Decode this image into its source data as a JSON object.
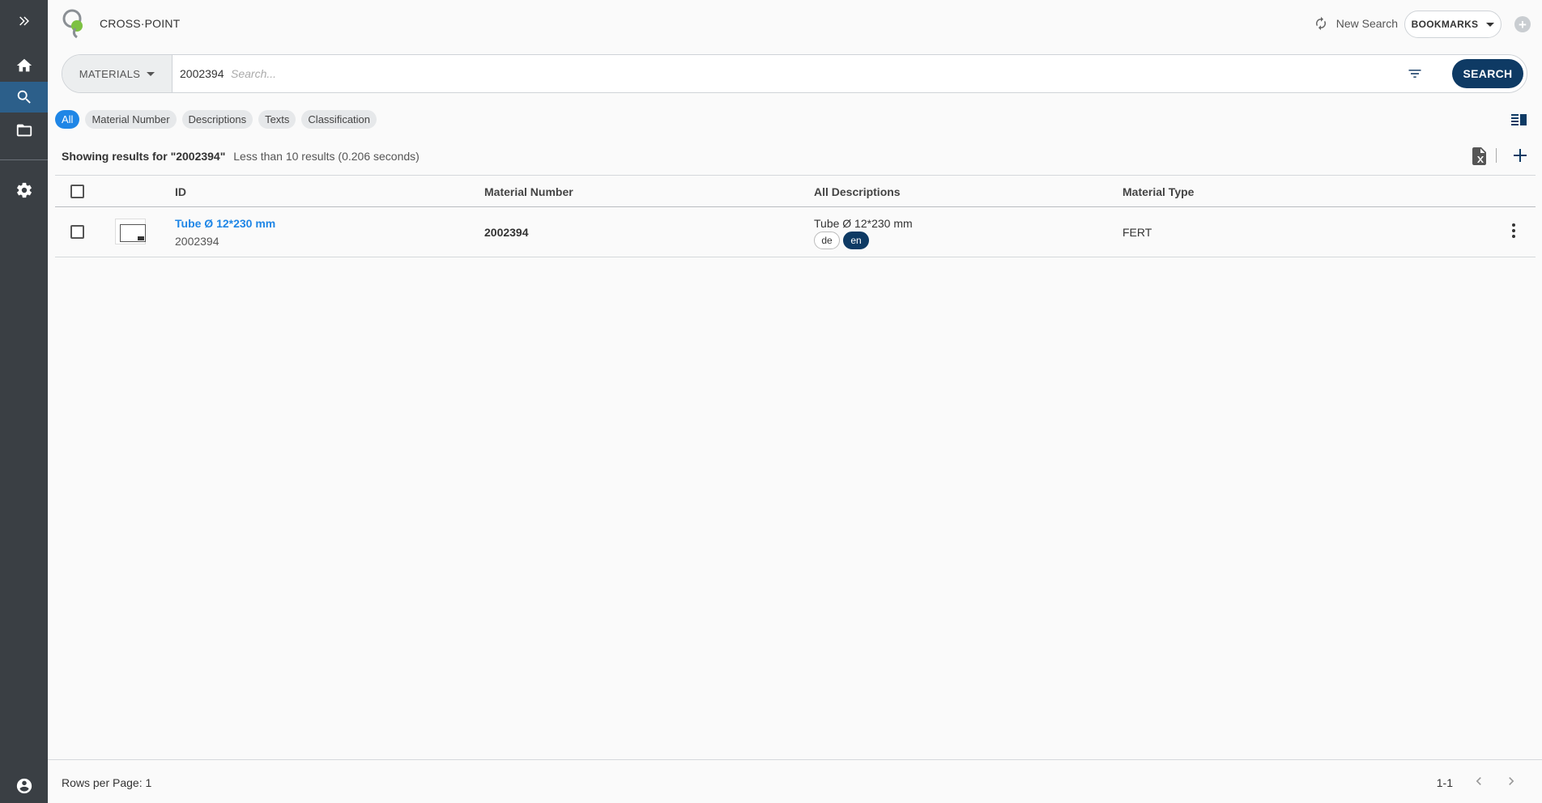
{
  "header": {
    "app_title": "CROSS·POINT",
    "new_search_label": "New Search",
    "bookmarks_label": "BOOKMARKS"
  },
  "sidebar": {
    "items": [
      {
        "icon": "expand-icon"
      },
      {
        "icon": "home-icon"
      },
      {
        "icon": "search-icon",
        "active": true
      },
      {
        "icon": "folder-icon"
      },
      {
        "icon": "gear-icon"
      },
      {
        "icon": "account-icon"
      }
    ]
  },
  "search": {
    "category_label": "MATERIALS",
    "query_value": "2002394",
    "placeholder": "Search...",
    "button_label": "SEARCH"
  },
  "filters": {
    "chips": [
      "All",
      "Material Number",
      "Descriptions",
      "Texts",
      "Classification"
    ],
    "active": "All"
  },
  "results": {
    "prefix": "Showing results for ",
    "query_quoted": "\"2002394\"",
    "meta": "Less than 10 results (0.206 seconds)"
  },
  "table": {
    "columns": [
      "ID",
      "Material Number",
      "All Descriptions",
      "Material Type"
    ],
    "rows": [
      {
        "title": "Tube Ø 12*230 mm",
        "id": "2002394",
        "material_number": "2002394",
        "description": "Tube Ø 12*230 mm",
        "languages": [
          "de",
          "en"
        ],
        "active_language": "en",
        "material_type": "FERT"
      }
    ]
  },
  "footer": {
    "rows_per_page": "Rows per Page: 1",
    "range": "1-1"
  },
  "colors": {
    "sidebar_bg": "#3a3f44",
    "primary": "#0e3a64",
    "accent": "#1f86e6",
    "logo_green": "#7dc142"
  }
}
